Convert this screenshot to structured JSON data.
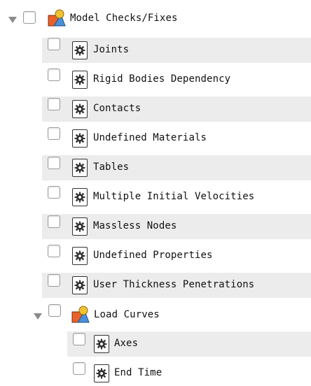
{
  "tree": {
    "root": {
      "label": "Model Checks/Fixes",
      "icon": "shapes-folder-icon",
      "expanded": true,
      "checked": false,
      "children": [
        {
          "label": "Joints",
          "icon": "gear-icon",
          "checked": false
        },
        {
          "label": "Rigid Bodies Dependency",
          "icon": "gear-icon",
          "checked": false
        },
        {
          "label": "Contacts",
          "icon": "gear-icon",
          "checked": false
        },
        {
          "label": "Undefined Materials",
          "icon": "gear-icon",
          "checked": false
        },
        {
          "label": "Tables",
          "icon": "gear-icon",
          "checked": false
        },
        {
          "label": "Multiple Initial Velocities",
          "icon": "gear-icon",
          "checked": false
        },
        {
          "label": "Massless Nodes",
          "icon": "gear-icon",
          "checked": false
        },
        {
          "label": "Undefined Properties",
          "icon": "gear-icon",
          "checked": false
        },
        {
          "label": "User Thickness Penetrations",
          "icon": "gear-icon",
          "checked": false
        }
      ]
    },
    "subgroup": {
      "label": "Load Curves",
      "icon": "shapes-folder-icon",
      "expanded": true,
      "checked": false,
      "children": [
        {
          "label": "Axes",
          "icon": "gear-icon",
          "checked": false
        },
        {
          "label": "End Time",
          "icon": "gear-icon",
          "checked": false
        }
      ]
    }
  },
  "colors": {
    "stripe": "#ececec",
    "folder_orange": "#e8622a",
    "folder_blue": "#4a90d9",
    "folder_yellow": "#f2c230"
  }
}
